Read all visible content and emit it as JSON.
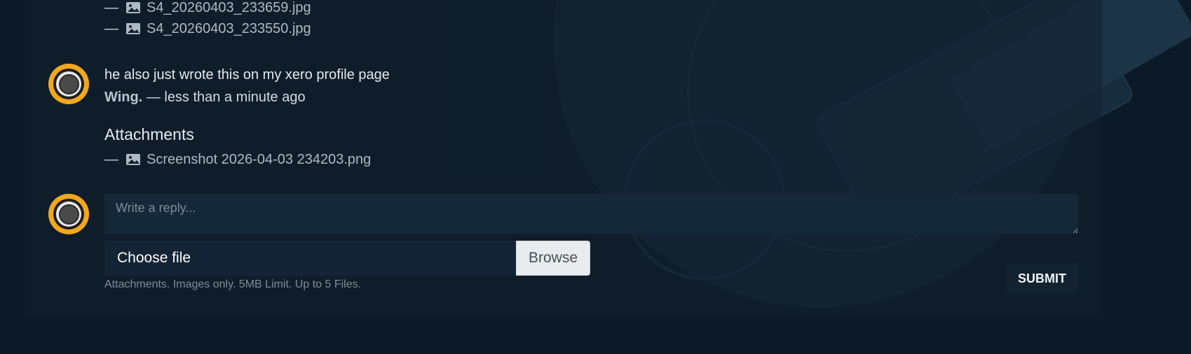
{
  "previous_attachments": [
    {
      "dash": "—",
      "icon": "image-icon",
      "filename": "S4_20260403_233659.jpg"
    },
    {
      "dash": "—",
      "icon": "image-icon",
      "filename": "S4_20260403_233550.jpg"
    }
  ],
  "comment": {
    "text": "he also just wrote this on my xero profile page",
    "author": "Wing.",
    "time": "— less than a minute ago",
    "attachments_title": "Attachments",
    "attachments": [
      {
        "dash": "—",
        "icon": "image-icon",
        "filename": "Screenshot 2026-04-03 234203.png"
      }
    ]
  },
  "reply_form": {
    "placeholder": "Write a reply...",
    "file_label": "Choose file",
    "browse_label": "Browse",
    "help_text": "Attachments. Images only. 5MB Limit. Up to 5 Files.",
    "submit_label": "SUBMIT"
  },
  "colors": {
    "avatar_ring": "#f3a81b",
    "background": "#0c1a27"
  }
}
